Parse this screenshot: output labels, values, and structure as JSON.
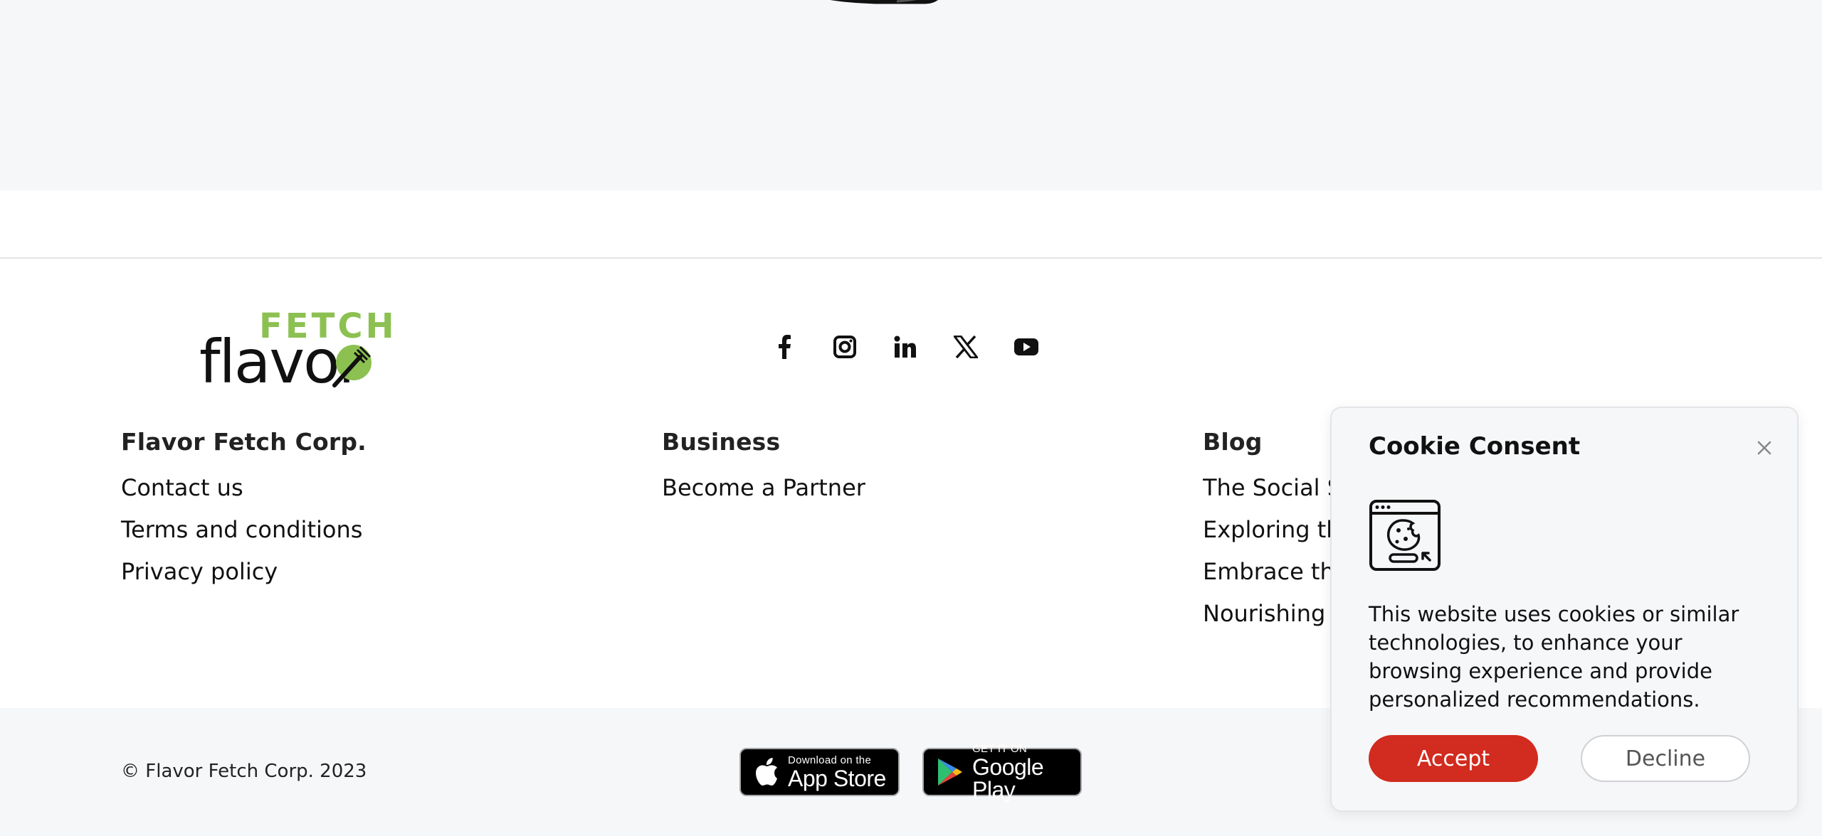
{
  "brand": {
    "logo_top": "FETCH",
    "logo_bottom": "flavor",
    "logo_accent": "#8cc152",
    "logo_dark": "#111111"
  },
  "socials": [
    {
      "icon": "facebook-icon"
    },
    {
      "icon": "instagram-icon"
    },
    {
      "icon": "linkedin-icon"
    },
    {
      "icon": "x-twitter-icon"
    },
    {
      "icon": "youtube-icon"
    }
  ],
  "footer": {
    "columns": [
      {
        "title": "Flavor Fetch Corp.",
        "links": [
          "Contact us",
          "Terms and conditions",
          "Privacy policy"
        ]
      },
      {
        "title": "Business",
        "links": [
          "Become a Partner"
        ]
      },
      {
        "title": "Blog",
        "links": [
          "The Social Si",
          "Exploring the",
          "Embrace the",
          "Nourishing th"
        ]
      }
    ],
    "copyright": "© Flavor Fetch Corp. 2023"
  },
  "stores": {
    "apple": {
      "small": "Download on the",
      "big": "App Store",
      "icon": "apple-icon"
    },
    "google": {
      "small": "GET IT ON",
      "big": "Google Play",
      "icon": "google-play-icon"
    }
  },
  "cookie": {
    "title": "Cookie Consent",
    "text": "This website uses cookies or similar technologies, to enhance your browsing experience and provide personalized recommendations.",
    "accept_label": "Accept",
    "decline_label": "Decline",
    "accept_color": "#d22b1f"
  }
}
